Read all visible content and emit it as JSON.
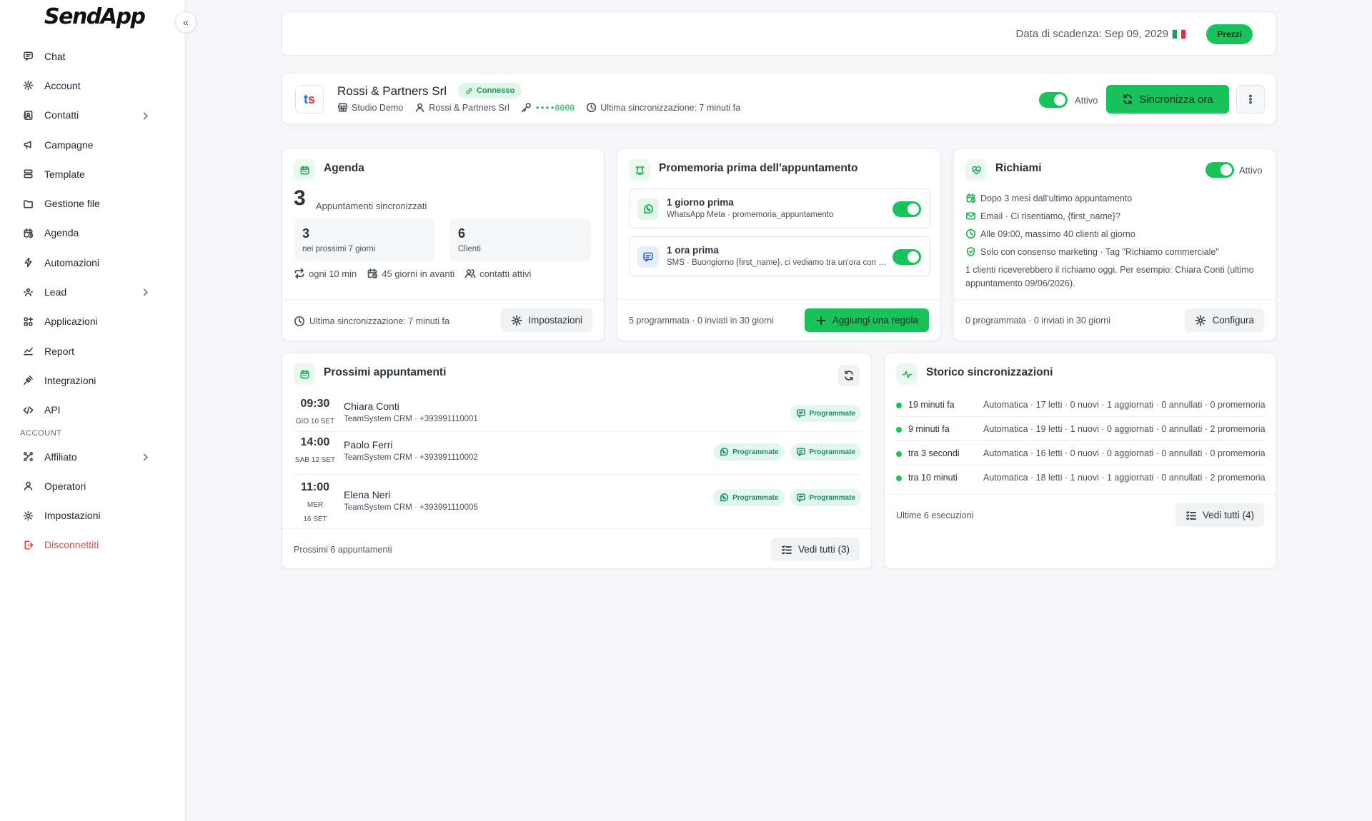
{
  "sidebar": {
    "logo": "SendApp",
    "collapse_glyph": "«",
    "items": [
      {
        "label": "Chat"
      },
      {
        "label": "Account"
      },
      {
        "label": "Contatti"
      },
      {
        "label": "Campagne"
      },
      {
        "label": "Template"
      },
      {
        "label": "Gestione file"
      },
      {
        "label": "Agenda"
      },
      {
        "label": "Automazioni"
      },
      {
        "label": "Lead"
      },
      {
        "label": "Applicazioni"
      },
      {
        "label": "Report"
      },
      {
        "label": "Integrazioni"
      },
      {
        "label": "API"
      }
    ],
    "section_label": "ACCOUNT",
    "account_items": [
      {
        "label": "Affiliato"
      },
      {
        "label": "Operatori"
      },
      {
        "label": "Impostazioni"
      },
      {
        "label": "Disconnettiti"
      }
    ]
  },
  "topbar": {
    "expiry": "Data di scadenza: Sep 09, 2029",
    "pricing_label": "Prezzi"
  },
  "integration": {
    "logo_t": "t",
    "logo_s": "s",
    "name": "Rossi & Partners Srl",
    "status_badge": "Connesso",
    "studio": "Studio Demo",
    "owner": "Rossi & Partners Srl",
    "key": "••••0000",
    "last_sync": "Ultima sincronizzazione: 7 minuti fa",
    "active_label": "Attivo",
    "sync_label": "Sincronizza ora"
  },
  "agenda": {
    "title": "Agenda",
    "synced_count": "3",
    "synced_label": "Appuntamenti sincronizzati",
    "next7_value": "3",
    "next7_label": "nei prossimi 7 giorni",
    "clients_value": "6",
    "clients_label": "Clienti",
    "frequency": "ogni 10 min",
    "window": "45 giorni in avanti",
    "contacts": "contatti attivi",
    "last_sync": "Ultima sincronizzazione: 7 minuti fa",
    "settings_label": "Impostazioni"
  },
  "reminders": {
    "title": "Promemoria prima dell'appuntamento",
    "rules": [
      {
        "title": "1 giorno prima",
        "detail": "WhatsApp Meta · promemoria_appuntamento"
      },
      {
        "title": "1 ora prima",
        "detail": "SMS · Buongiorno {first_name}, ci vediamo tra un'ora con il nostro appuntamento"
      }
    ],
    "footer": "5 programmata · 0 inviati in 30 giorni",
    "add_rule_label": "Aggiungi una regola"
  },
  "recalls": {
    "title": "Richiami",
    "active_label": "Attivo",
    "lines": [
      "Dopo 3 mesi dall'ultimo appuntamento",
      "Email · Ci risentiamo, {first_name}?",
      "Alle 09:00, massimo 40 clienti al giorno",
      "Solo con consenso marketing · Tag \"Richiamo commerciale\""
    ],
    "preview": "1 clienti riceverebbero il richiamo oggi. Per esempio: Chiara Conti (ultimo appuntamento 09/06/2026).",
    "footer": "0 programmata · 0 inviati in 30 giorni",
    "configure_label": "Configura"
  },
  "appointments": {
    "title": "Prossimi appuntamenti",
    "rows": [
      {
        "time": "09:30",
        "day": "GIO 10 SET",
        "name": "Chiara Conti",
        "sub": "TeamSystem CRM · +393991110001",
        "tags": [
          "Programmate"
        ]
      },
      {
        "time": "14:00",
        "day": "SAB 12 SET",
        "name": "Paolo Ferri",
        "sub": "TeamSystem CRM · +393991110002",
        "tags": [
          "Programmate",
          "Programmate"
        ]
      },
      {
        "time": "11:00",
        "day": "MER 16 SET",
        "name": "Elena Neri",
        "sub": "TeamSystem CRM · +393991110005",
        "tags": [
          "Programmate",
          "Programmate"
        ]
      }
    ],
    "footer": "Prossimi 6 appuntamenti",
    "see_all_label": "Vedi tutti (3)"
  },
  "history": {
    "title": "Storico sincronizzazioni",
    "rows": [
      {
        "when": "19 minuti fa",
        "what": "Automatica · 17 letti · 0 nuovi · 1 aggiornati · 0 annullati · 0 promemoria"
      },
      {
        "when": "9 minuti fa",
        "what": "Automatica · 19 letti · 1 nuovi · 0 aggiornati · 0 annullati · 2 promemoria"
      },
      {
        "when": "tra 3 secondi",
        "what": "Automatica · 16 letti · 0 nuovi · 0 aggiornati · 0 annullati · 0 promemoria"
      },
      {
        "when": "tra 10 minuti",
        "what": "Automatica · 18 letti · 1 nuovi · 1 aggiornati · 0 annullati · 2 promemoria"
      }
    ],
    "footer": "Ultime 6 esecuzioni",
    "see_all_label": "Vedi tutti (4)"
  },
  "colors": {
    "accent": "#19c35c",
    "danger": "#e2473f",
    "flag_green": "#1f9d55",
    "flag_white": "#ffffff",
    "flag_red": "#d8343b"
  }
}
